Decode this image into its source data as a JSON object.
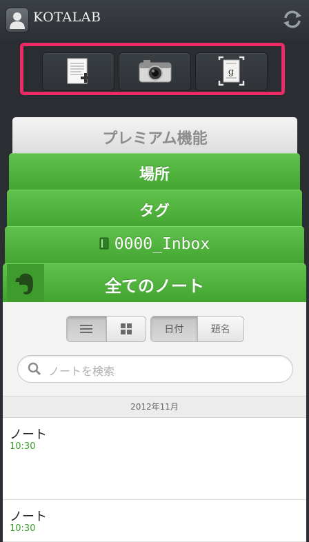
{
  "header": {
    "account_name": "KOTALAB"
  },
  "quick_actions": [
    {
      "icon": "new-text-note-icon"
    },
    {
      "icon": "camera-icon"
    },
    {
      "icon": "document-scan-icon"
    }
  ],
  "stack": {
    "premium": "プレミアム機能",
    "places": "場所",
    "tags": "タグ",
    "notebook": "0000_Inbox",
    "all_notes": "全てのノート"
  },
  "view_toggle": {
    "list": "list-view-icon",
    "grid": "grid-view-icon"
  },
  "sort": {
    "date": "日付",
    "title": "題名"
  },
  "search": {
    "placeholder": "ノートを検索"
  },
  "section_date": "2012年11月",
  "notes": [
    {
      "title": "ノート",
      "time": "10:30"
    },
    {
      "title": "ノート",
      "time": "10:30"
    }
  ],
  "colors": {
    "accent_green": "#4cae37",
    "highlight": "#ec2a66",
    "time_green": "#3a9a2a"
  }
}
